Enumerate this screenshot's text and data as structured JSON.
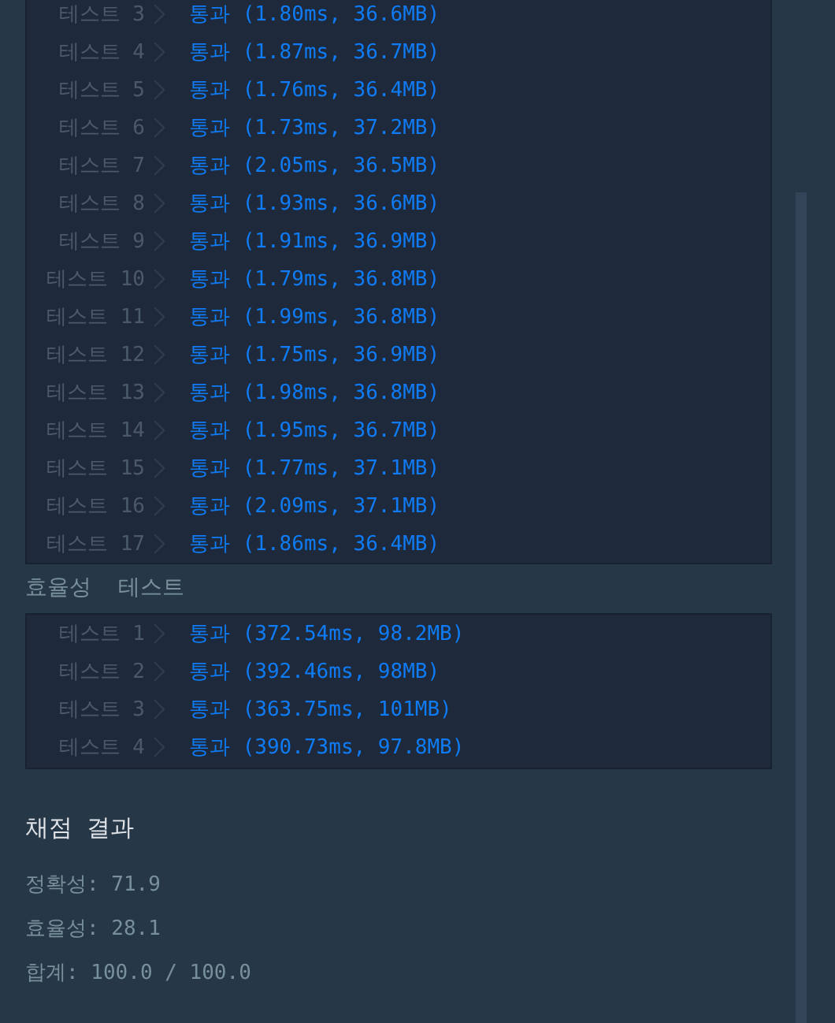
{
  "accuracy_tests": [
    {
      "label": "테스트 3",
      "result": "통과 (1.80ms, 36.6MB)"
    },
    {
      "label": "테스트 4",
      "result": "통과 (1.87ms, 36.7MB)"
    },
    {
      "label": "테스트 5",
      "result": "통과 (1.76ms, 36.4MB)"
    },
    {
      "label": "테스트 6",
      "result": "통과 (1.73ms, 37.2MB)"
    },
    {
      "label": "테스트 7",
      "result": "통과 (2.05ms, 36.5MB)"
    },
    {
      "label": "테스트 8",
      "result": "통과 (1.93ms, 36.6MB)"
    },
    {
      "label": "테스트 9",
      "result": "통과 (1.91ms, 36.9MB)"
    },
    {
      "label": "테스트 10",
      "result": "통과 (1.79ms, 36.8MB)"
    },
    {
      "label": "테스트 11",
      "result": "통과 (1.99ms, 36.8MB)"
    },
    {
      "label": "테스트 12",
      "result": "통과 (1.75ms, 36.9MB)"
    },
    {
      "label": "테스트 13",
      "result": "통과 (1.98ms, 36.8MB)"
    },
    {
      "label": "테스트 14",
      "result": "통과 (1.95ms, 36.7MB)"
    },
    {
      "label": "테스트 15",
      "result": "통과 (1.77ms, 37.1MB)"
    },
    {
      "label": "테스트 16",
      "result": "통과 (2.09ms, 37.1MB)"
    },
    {
      "label": "테스트 17",
      "result": "통과 (1.86ms, 36.4MB)"
    }
  ],
  "efficiency_section": {
    "title": "효율성  테스트",
    "tests": [
      {
        "label": "테스트 1",
        "result": "통과 (372.54ms, 98.2MB)"
      },
      {
        "label": "테스트 2",
        "result": "통과 (392.46ms, 98MB)"
      },
      {
        "label": "테스트 3",
        "result": "통과 (363.75ms, 101MB)"
      },
      {
        "label": "테스트 4",
        "result": "통과 (390.73ms, 97.8MB)"
      }
    ]
  },
  "grading": {
    "title": "채점 결과",
    "lines": [
      "정확성: 71.9",
      "효율성: 28.1",
      "합계: 100.0 / 100.0"
    ]
  }
}
